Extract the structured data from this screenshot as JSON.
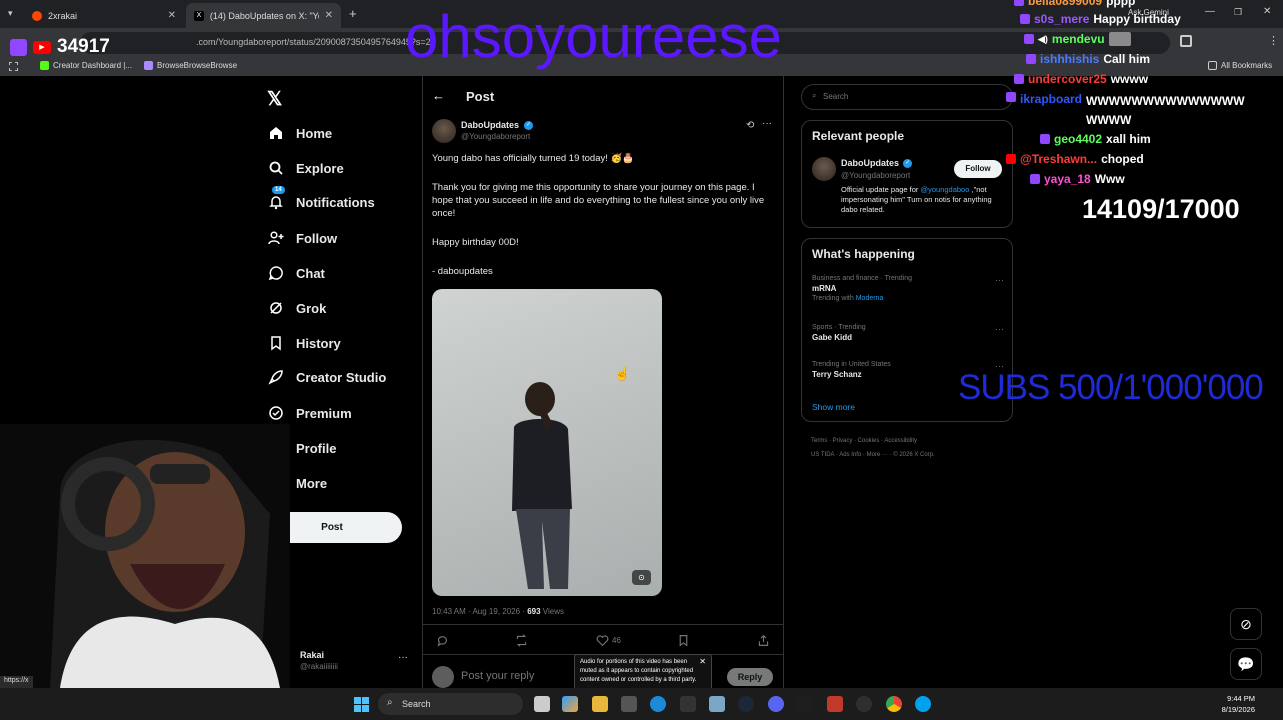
{
  "browser": {
    "tabs": [
      {
        "title": "2xrakai"
      },
      {
        "title": "(14) DaboUpdates on X: \"Young"
      }
    ],
    "new_tab": "+",
    "url": ".com/Youngdaboreport/status/2090087350495764945?s=20",
    "bookmarks": [
      "Creator Dashboard |...",
      "BrowseBrowseBrowse"
    ],
    "all_bookmarks": "All Bookmarks",
    "ask_gemini": "Ask Gemini",
    "status_text": "https://x"
  },
  "stream": {
    "viewer_count": "34917",
    "streamer_handle": "ohsoyoureese",
    "goal": "14109/17000",
    "subs_goal": "SUBS 500/1'000'000"
  },
  "chat": [
    {
      "user": "bella0899009",
      "msg": "pppp",
      "color": "#ff9a3c"
    },
    {
      "user": "s0s_mere",
      "msg": "Happy birthday",
      "color": "#9b59ff"
    },
    {
      "user": "mendevu",
      "msg": "",
      "color": "#5cff5c"
    },
    {
      "user": "ishhhishis",
      "msg": "Call him",
      "color": "#4a7bff"
    },
    {
      "user": "undercover25",
      "msg": "wwww",
      "color": "#ff3b3b"
    },
    {
      "user": "ikrapboard",
      "msg": "WWWWWWWWWWWWWW WWWW",
      "color": "#3355ff"
    },
    {
      "user": "geo4402",
      "msg": "xall him",
      "color": "#5cff5c"
    },
    {
      "user": "@Treshawn...",
      "msg": "choped",
      "color": "#ff3b3b"
    },
    {
      "user": "yaya_18",
      "msg": "Www",
      "color": "#ff4fd8"
    }
  ],
  "nav": {
    "items": [
      {
        "label": "Home",
        "icon": "home-icon"
      },
      {
        "label": "Explore",
        "icon": "search-icon"
      },
      {
        "label": "Notifications",
        "icon": "bell-icon",
        "badge": "14"
      },
      {
        "label": "Follow",
        "icon": "add-user-icon"
      },
      {
        "label": "Chat",
        "icon": "chat-icon"
      },
      {
        "label": "Grok",
        "icon": "grok-icon"
      },
      {
        "label": "History",
        "icon": "bookmark-icon"
      },
      {
        "label": "Creator Studio",
        "icon": "rocket-icon"
      },
      {
        "label": "Premium",
        "icon": "verified-icon"
      },
      {
        "label": "Profile",
        "icon": "user-icon"
      },
      {
        "label": "More",
        "icon": "more-icon"
      }
    ],
    "post_label": "Post",
    "account_name": "Rakai",
    "account_handle": "@rakaiiiiiiii"
  },
  "post": {
    "header": "Post",
    "author_name": "DaboUpdates",
    "author_handle": "@Youngdaboreport",
    "text_1": "Young dabo has officially turned 19 today! 🥳🎂",
    "text_2": "Thank you for giving me this opportunity to share your journey on this page. I hope that you succeed in life and do everything  to the fullest since you only live once!",
    "text_3": "Happy birthday 00D!",
    "text_4": "- daboupdates",
    "timestamp": "10:43 AM · Aug 19, 2026 · ",
    "views_count": "693",
    "views_label": " Views",
    "likes": "46",
    "reply_placeholder": "Post your reply",
    "reply_button": "Reply"
  },
  "search": {
    "placeholder": "Search"
  },
  "relevant": {
    "title": "Relevant people",
    "name": "DaboUpdates",
    "handle": "@Youngdaboreport",
    "follow": "Follow",
    "bio_1": "Official update page for ",
    "bio_mention": "@youngdaboo",
    "bio_2": " ,\"not impersonating him\" Turn on notis for anything dabo related."
  },
  "happening": {
    "title": "What's happening",
    "trends": [
      {
        "meta": "Business and finance · Trending",
        "name": "mRNA",
        "extra": "Trending with ",
        "link": "Moderna"
      },
      {
        "meta": "Sports · Trending",
        "name": "Gabe Kidd"
      },
      {
        "meta": "Trending in United States",
        "name": "Terry Schanz"
      }
    ],
    "show_more": "Show more",
    "footer_1": "Terms   ·   Privacy   ·   Cookies   ·   Accessibility",
    "footer_2": "US TIDA   ·   Ads Info   ·   More ···   ·   © 2026 X Corp."
  },
  "notice": "Audio for portions of this video has been muted as it appears to contain copyrighted content owned or controlled by a third party.",
  "taskbar": {
    "search": "Search",
    "time": "9:44 PM",
    "date": "8/19/2026"
  },
  "colors": {
    "accent": "#1d9bf0",
    "handle_purple": "#5b17ff",
    "twitch": "#9146ff"
  }
}
